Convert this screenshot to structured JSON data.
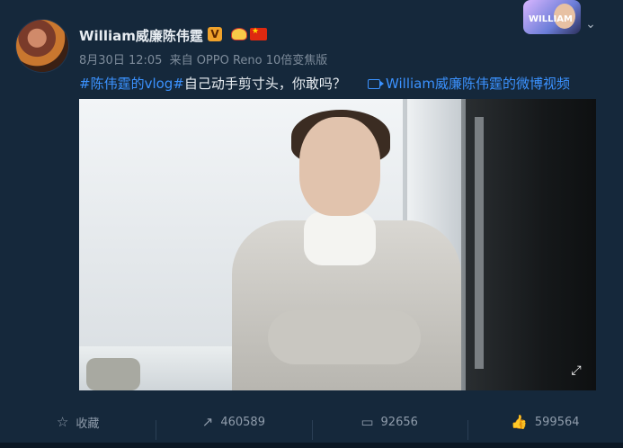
{
  "post": {
    "author": "William威廉陈伟霆",
    "meta": {
      "date": "8月30日 12:05",
      "source": "来自 OPPO Reno 10倍变焦版"
    },
    "text": {
      "hashtag": "#陈伟霆的vlog#",
      "body": "自己动手剪寸头，你敢吗？"
    },
    "video_link": "William威廉陈伟霆的微博视频",
    "badges": [
      "verified-v-badge",
      "crown-badge",
      "china-flag-badge"
    ],
    "sticker_text": "WILLIAM"
  },
  "actions": {
    "favorite": {
      "label": "收藏",
      "icon": "star-icon"
    },
    "repost": {
      "count": "460589",
      "icon": "repost-icon"
    },
    "comment": {
      "count": "92656",
      "icon": "comment-icon"
    },
    "like": {
      "count": "599564",
      "icon": "thumb-up-icon"
    }
  },
  "colors": {
    "background": "#15283b",
    "link": "#3b92ff",
    "text": "#e8edf2",
    "muted": "#7e8c9b"
  }
}
